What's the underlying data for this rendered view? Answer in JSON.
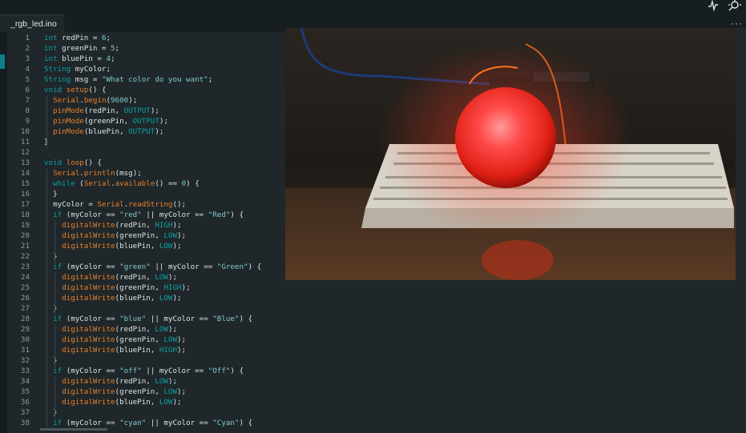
{
  "tab": {
    "filename": "_rgb_led.ino"
  },
  "toolbar": {
    "more": "···",
    "icons": [
      "serial-plotter-icon",
      "serial-monitor-icon"
    ]
  },
  "code": {
    "lines": [
      {
        "n": "1",
        "t": "int redPin = 6;"
      },
      {
        "n": "2",
        "t": "int greenPin = 5;"
      },
      {
        "n": "3",
        "t": "int bluePin = 4;"
      },
      {
        "n": "4",
        "t": "String myColor;"
      },
      {
        "n": "5",
        "t": "String msg = \"What color do you want\";"
      },
      {
        "n": "6",
        "t": "void setup() {"
      },
      {
        "n": "7",
        "t": "  Serial.begin(9600);"
      },
      {
        "n": "8",
        "t": "  pinMode(redPin, OUTPUT);"
      },
      {
        "n": "9",
        "t": "  pinMode(greenPin, OUTPUT);"
      },
      {
        "n": "10",
        "t": "  pinMode(bluePin, OUTPUT);"
      },
      {
        "n": "11",
        "t": "}"
      },
      {
        "n": "12",
        "t": ""
      },
      {
        "n": "13",
        "t": "void loop() {"
      },
      {
        "n": "14",
        "t": "  Serial.println(msg);"
      },
      {
        "n": "15",
        "t": "  while (Serial.available() == 0) {"
      },
      {
        "n": "16",
        "t": "  }"
      },
      {
        "n": "17",
        "t": "  myColor = Serial.readString();"
      },
      {
        "n": "18",
        "t": "  if (myColor == \"red\" || myColor == \"Red\") {"
      },
      {
        "n": "19",
        "t": "    digitalWrite(redPin, HIGH);"
      },
      {
        "n": "20",
        "t": "    digitalWrite(greenPin, LOW);"
      },
      {
        "n": "21",
        "t": "    digitalWrite(bluePin, LOW);"
      },
      {
        "n": "22",
        "t": "  }"
      },
      {
        "n": "23",
        "t": "  if (myColor == \"green\" || myColor == \"Green\") {"
      },
      {
        "n": "24",
        "t": "    digitalWrite(redPin, LOW);"
      },
      {
        "n": "25",
        "t": "    digitalWrite(greenPin, HIGH);"
      },
      {
        "n": "26",
        "t": "    digitalWrite(bluePin, LOW);"
      },
      {
        "n": "27",
        "t": "  }"
      },
      {
        "n": "28",
        "t": "  if (myColor == \"blue\" || myColor == \"Blue\") {"
      },
      {
        "n": "29",
        "t": "    digitalWrite(redPin, LOW);"
      },
      {
        "n": "30",
        "t": "    digitalWrite(greenPin, LOW);"
      },
      {
        "n": "31",
        "t": "    digitalWrite(bluePin, HIGH);"
      },
      {
        "n": "32",
        "t": "  }"
      },
      {
        "n": "33",
        "t": "  if (myColor == \"off\" || myColor == \"Off\") {"
      },
      {
        "n": "34",
        "t": "    digitalWrite(redPin, LOW);"
      },
      {
        "n": "35",
        "t": "    digitalWrite(greenPin, LOW);"
      },
      {
        "n": "36",
        "t": "    digitalWrite(bluePin, LOW);"
      },
      {
        "n": "37",
        "t": "  }"
      },
      {
        "n": "38",
        "t": "  if (myColor == \"cyan\" || myColor == \"Cyan\") {"
      }
    ]
  },
  "syntax": {
    "keywords": [
      "int",
      "String",
      "void",
      "if",
      "while",
      "HIGH",
      "LOW",
      "OUTPUT"
    ],
    "functions": [
      "setup",
      "loop",
      "Serial",
      "begin",
      "println",
      "available",
      "readString",
      "pinMode",
      "digitalWrite"
    ]
  },
  "colors": {
    "background": "#1f272a",
    "keyword": "#0ca1a6",
    "function": "#e97f2b",
    "string": "#7fcbcd",
    "text": "#dfe3e4",
    "line_number": "#8e9ba0"
  },
  "video": {
    "subject": "red-glowing-led-ball-on-breadboard"
  }
}
